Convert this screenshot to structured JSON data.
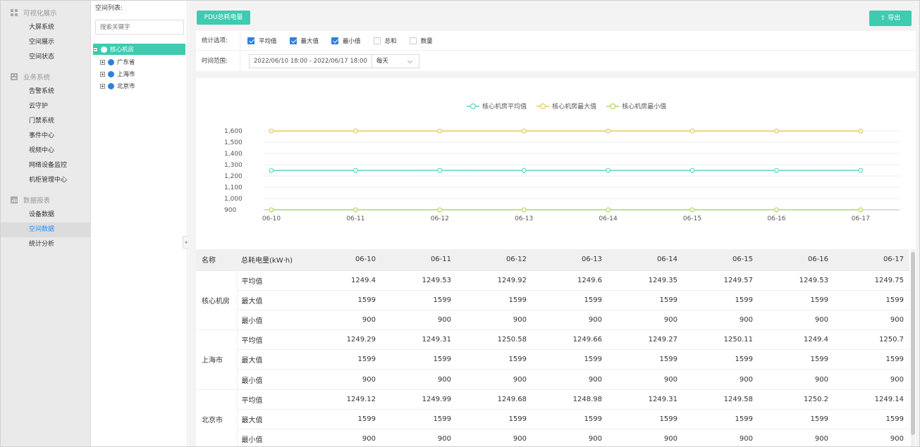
{
  "nav": {
    "groups": [
      {
        "label": "可视化展示",
        "items": [
          "大屏系统",
          "空间展示",
          "空间状态"
        ]
      },
      {
        "label": "业务系统",
        "items": [
          "告警系统",
          "云守护",
          "门禁系统",
          "事件中心",
          "视频中心",
          "网络设备监控",
          "机柜管理中心"
        ]
      },
      {
        "label": "数据报表",
        "items": [
          "设备数据",
          "空间数据",
          "统计分析"
        ]
      }
    ],
    "active_item": "空间数据"
  },
  "tree": {
    "title": "空间列表:",
    "search_placeholder": "搜索关键字",
    "root": "核心机房",
    "children": [
      "广东省",
      "上海市",
      "北京市"
    ]
  },
  "toolbar": {
    "tab_label": "PDU总耗电量",
    "export_label": "导出"
  },
  "filters": {
    "stats_label": "统计选项:",
    "options": [
      {
        "label": "平均值",
        "checked": true
      },
      {
        "label": "最大值",
        "checked": true
      },
      {
        "label": "最小值",
        "checked": true
      },
      {
        "label": "总和",
        "checked": false
      },
      {
        "label": "数量",
        "checked": false
      }
    ],
    "time_label": "时间范围:",
    "date_range": "2022/06/10 18:00 - 2022/06/17 18:00",
    "frequency": "每天"
  },
  "chart_data": {
    "type": "line",
    "categories": [
      "06-10",
      "06-11",
      "06-12",
      "06-13",
      "06-14",
      "06-15",
      "06-16",
      "06-17"
    ],
    "series": [
      {
        "name": "核心机房平均值",
        "color": "#5ed3c9",
        "values": [
          1249.4,
          1249.53,
          1249.92,
          1249.6,
          1249.35,
          1249.57,
          1249.53,
          1249.75
        ]
      },
      {
        "name": "核心机房最大值",
        "color": "#e8c662",
        "values": [
          1599,
          1599,
          1599,
          1599,
          1599,
          1599,
          1599,
          1599
        ]
      },
      {
        "name": "核心机房最小值",
        "color": "#b3d65e",
        "values": [
          900,
          900,
          900,
          900,
          900,
          900,
          900,
          900
        ]
      }
    ],
    "yticks": [
      "1,600",
      "1,500",
      "1,400",
      "1,300",
      "1,200",
      "1,100",
      "1,000",
      "900"
    ],
    "ylim": [
      900,
      1600
    ],
    "legend_position": "top-center"
  },
  "table": {
    "headers": [
      "名称",
      "总耗电量(kW·h)",
      "06-10",
      "06-11",
      "06-12",
      "06-13",
      "06-14",
      "06-15",
      "06-16",
      "06-17"
    ],
    "groups": [
      {
        "name": "核心机房",
        "rows": [
          {
            "metric": "平均值",
            "values": [
              "1249.4",
              "1249.53",
              "1249.92",
              "1249.6",
              "1249.35",
              "1249.57",
              "1249.53",
              "1249.75"
            ]
          },
          {
            "metric": "最大值",
            "values": [
              "1599",
              "1599",
              "1599",
              "1599",
              "1599",
              "1599",
              "1599",
              "1599"
            ]
          },
          {
            "metric": "最小值",
            "values": [
              "900",
              "900",
              "900",
              "900",
              "900",
              "900",
              "900",
              "900"
            ]
          }
        ]
      },
      {
        "name": "上海市",
        "rows": [
          {
            "metric": "平均值",
            "values": [
              "1249.29",
              "1249.31",
              "1250.58",
              "1249.66",
              "1249.27",
              "1250.11",
              "1249.4",
              "1250.7"
            ]
          },
          {
            "metric": "最大值",
            "values": [
              "1599",
              "1599",
              "1599",
              "1599",
              "1599",
              "1599",
              "1599",
              "1599"
            ]
          },
          {
            "metric": "最小值",
            "values": [
              "900",
              "900",
              "900",
              "900",
              "900",
              "900",
              "900",
              "900"
            ]
          }
        ]
      },
      {
        "name": "北京市",
        "rows": [
          {
            "metric": "平均值",
            "values": [
              "1249.12",
              "1249.99",
              "1249.68",
              "1248.98",
              "1249.31",
              "1249.58",
              "1250.2",
              "1249.14"
            ]
          },
          {
            "metric": "最大值",
            "values": [
              "1599",
              "1599",
              "1599",
              "1599",
              "1599",
              "1599",
              "1599",
              "1599"
            ]
          },
          {
            "metric": "最小值",
            "values": [
              "900",
              "900",
              "900",
              "900",
              "900",
              "900",
              "900",
              "900"
            ]
          }
        ]
      }
    ]
  }
}
